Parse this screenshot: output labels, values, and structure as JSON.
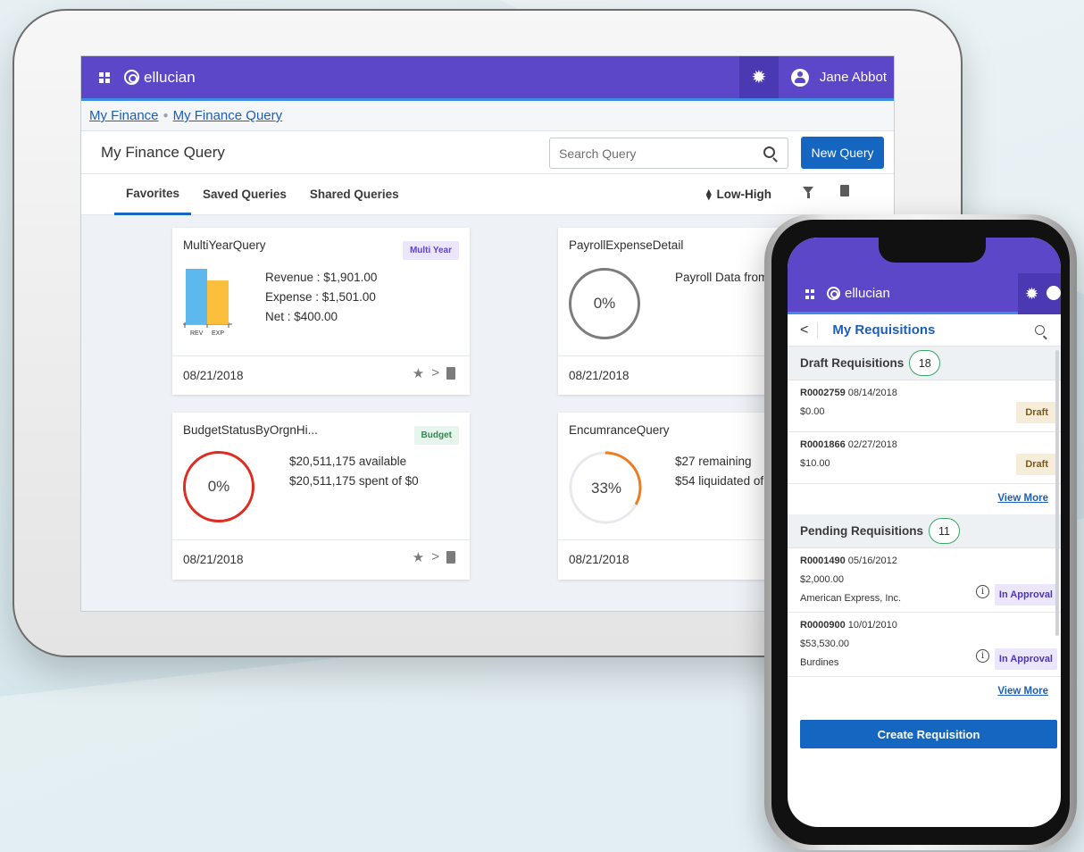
{
  "brand": "ellucian",
  "user": "Jane Abbot",
  "breadcrumb": [
    "My Finance",
    "My Finance Query"
  ],
  "page_title": "My Finance Query",
  "search_placeholder": "Search Query",
  "new_query_label": "New Query",
  "tabs": [
    "Favorites",
    "Saved Queries",
    "Shared Queries"
  ],
  "sort_label": "Low-High",
  "cards": [
    {
      "title": "MultiYearQuery",
      "badge": "Multi Year",
      "lines": [
        "Revenue : $1,901.00",
        "Expense : $1,501.00",
        "Net : $400.00"
      ],
      "chart_labels": [
        "REV",
        "EXP"
      ],
      "chart_values": [
        1901,
        1501
      ],
      "date": "08/21/2018"
    },
    {
      "title": "PayrollExpenseDetail",
      "percent": "0%",
      "lines": [
        "Payroll Data from"
      ],
      "date": "08/21/2018"
    },
    {
      "title": "BudgetStatusByOrgnHi...",
      "badge": "Budget",
      "percent": "0%",
      "lines": [
        "$20,511,175 available",
        "$20,511,175 spent of $0"
      ],
      "date": "08/21/2018"
    },
    {
      "title": "EncumranceQuery",
      "percent": "33%",
      "percent_value": 0.33,
      "lines": [
        "$27 remaining",
        "$54 liquidated of $"
      ],
      "date": "08/21/2018"
    }
  ],
  "colors": {
    "header": "#5b47c8",
    "accent_blue": "#1466c0",
    "bar_rev": "#5db8ee",
    "bar_exp": "#fbbf3c",
    "ring_red": "#e02b20",
    "ring_orange": "#f07a1e"
  },
  "phone": {
    "brand": "ellucian",
    "title": "My Requisitions",
    "draft_section": "Draft Requisitions",
    "draft_count": "18",
    "pending_section": "Pending Requisitions",
    "pending_count": "11",
    "view_more": "View More",
    "create_label": "Create Requisition",
    "drafts": [
      {
        "id": "R0002759",
        "date": "08/14/2018",
        "amount": "$0.00",
        "status": "Draft"
      },
      {
        "id": "R0001866",
        "date": "02/27/2018",
        "amount": "$10.00",
        "status": "Draft"
      }
    ],
    "pending": [
      {
        "id": "R0001490",
        "date": "05/16/2012",
        "amount": "$2,000.00",
        "vendor": "American Express, Inc.",
        "status": "In Approval"
      },
      {
        "id": "R0000900",
        "date": "10/01/2010",
        "amount": "$53,530.00",
        "vendor": "Burdines",
        "status": "In Approval"
      }
    ]
  }
}
